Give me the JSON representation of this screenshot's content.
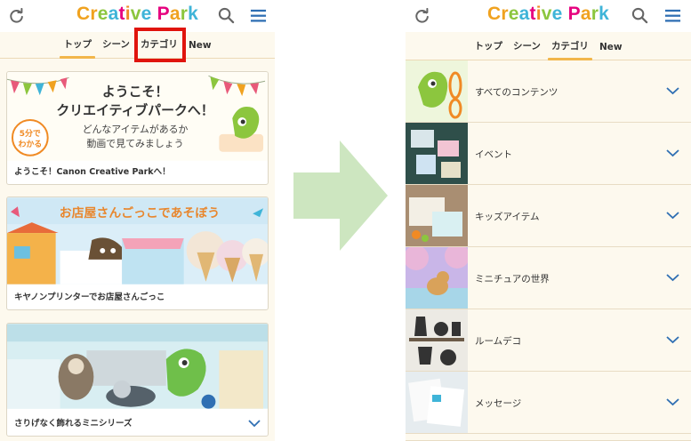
{
  "brand": {
    "logo_letters": [
      {
        "ch": "C",
        "color": "#f0a21f"
      },
      {
        "ch": "r",
        "color": "#f0a21f"
      },
      {
        "ch": "e",
        "color": "#8cc63e"
      },
      {
        "ch": "a",
        "color": "#3fb4d8"
      },
      {
        "ch": "t",
        "color": "#e6007e"
      },
      {
        "ch": "i",
        "color": "#f08a24"
      },
      {
        "ch": "v",
        "color": "#8cc63e"
      },
      {
        "ch": "e",
        "color": "#3fb4d8"
      },
      {
        "ch": " ",
        "color": "#ffffff"
      },
      {
        "ch": "P",
        "color": "#e6007e"
      },
      {
        "ch": "a",
        "color": "#f0a21f"
      },
      {
        "ch": "r",
        "color": "#8cc63e"
      },
      {
        "ch": "k",
        "color": "#3fb4d8"
      }
    ],
    "accent": "#f2b64b",
    "icon_color": "#2f6fb3"
  },
  "left": {
    "tabs": [
      {
        "label": "トップ",
        "active": true
      },
      {
        "label": "シーン",
        "active": false
      },
      {
        "label": "カテゴリ",
        "active": false
      },
      {
        "label": "New",
        "active": false
      }
    ],
    "cards": [
      {
        "headline1": "ようこそ！",
        "headline2": "クリエイティブパークへ！",
        "sub1": "どんなアイテムがあるか",
        "sub2": "動画で見てみましょう",
        "badge": "5分で\nわかる",
        "caption": "ようこそ！Canon Creative Parkへ！"
      },
      {
        "banner": "お店屋さんごっこであそぼう",
        "caption": "キヤノンプリンターでお店屋さんごっこ"
      },
      {
        "caption": "さりげなく飾れるミニシリーズ"
      }
    ]
  },
  "right": {
    "tabs": [
      {
        "label": "トップ",
        "active": false
      },
      {
        "label": "シーン",
        "active": false
      },
      {
        "label": "カテゴリ",
        "active": true
      },
      {
        "label": "New",
        "active": false
      }
    ],
    "categories": [
      {
        "label": "すべてのコンテンツ",
        "icon": "chameleon-scissors"
      },
      {
        "label": "イベント",
        "icon": "chalkboard"
      },
      {
        "label": "キッズアイテム",
        "icon": "craft-table"
      },
      {
        "label": "ミニチュアの世界",
        "icon": "cherry-blossom"
      },
      {
        "label": "ルームデコ",
        "icon": "shelf-decor"
      },
      {
        "label": "メッセージ",
        "icon": "cards"
      }
    ]
  }
}
